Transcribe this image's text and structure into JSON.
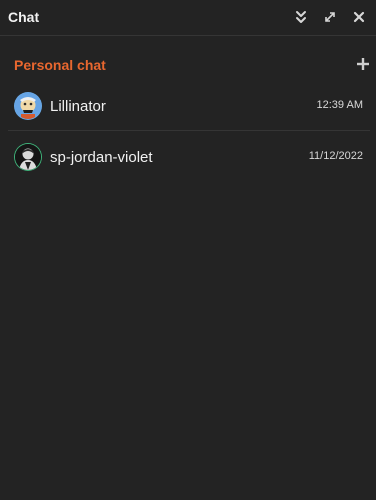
{
  "window": {
    "title": "Chat",
    "buttons": {
      "collapse_icon": "double-chevron-down-icon",
      "expand_icon": "expand-arrows-icon",
      "close_icon": "close-icon"
    }
  },
  "section": {
    "title": "Personal chat",
    "add_icon": "plus-icon"
  },
  "chats": [
    {
      "name": "Lillinator",
      "time": "12:39 AM"
    },
    {
      "name": "sp-jordan-violet",
      "time": "11/12/2022"
    }
  ],
  "colors": {
    "background": "#232323",
    "section_accent": "#e8672f",
    "text_primary": "#f1f1f1",
    "divider": "#353535"
  }
}
